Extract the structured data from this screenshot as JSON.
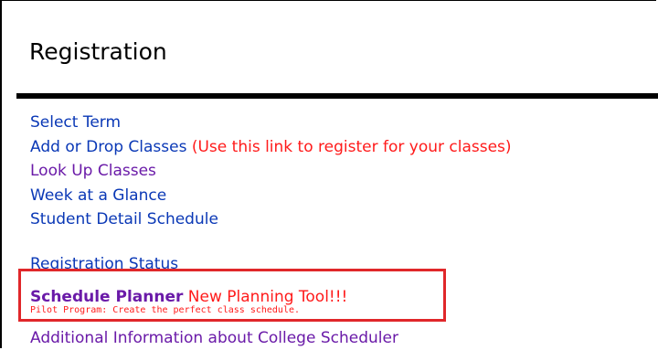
{
  "page": {
    "title": "Registration"
  },
  "menu": {
    "items": [
      {
        "label": "Select Term",
        "note": ""
      },
      {
        "label": "Add or Drop Classes",
        "note": " (Use this link to register for your classes)"
      },
      {
        "label": "Look Up Classes",
        "note": ""
      },
      {
        "label": "Week at a Glance",
        "note": ""
      },
      {
        "label": "Student Detail Schedule",
        "note": ""
      }
    ],
    "registration_status": "Registration Status",
    "schedule_planner": {
      "label": "Schedule Planner",
      "note": " New Planning Tool!!!",
      "sub_note": "Pilot Program: Create the perfect class schedule."
    },
    "additional_info": "Additional Information about College Scheduler"
  },
  "colors": {
    "link_unvisited": "#0a38b6",
    "link_visited": "#6a1aa8",
    "note_red": "#ff1a1a",
    "highlight_border": "#e0272a"
  }
}
